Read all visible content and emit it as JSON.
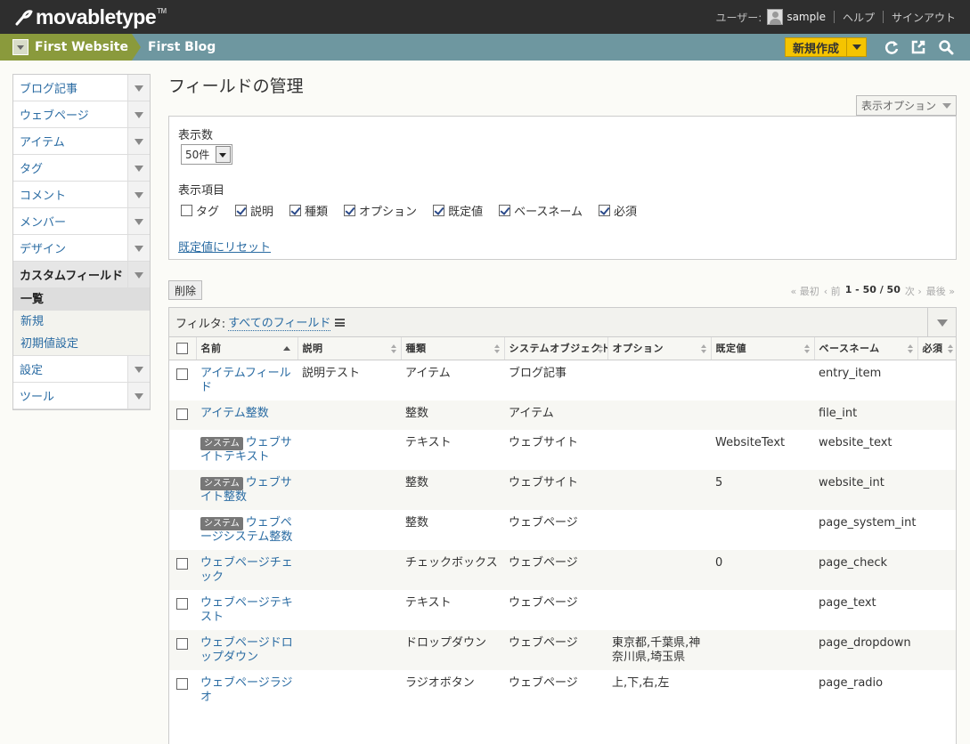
{
  "header": {
    "logo": "movabletype",
    "tm": "TM",
    "user_label": "ユーザー:",
    "user_name": "sample",
    "help": "ヘルプ",
    "signout": "サインアウト"
  },
  "sitebar": {
    "website": "First Website",
    "blog": "First Blog",
    "new_button": "新規作成"
  },
  "sidebar": {
    "items": [
      {
        "label": "ブログ記事"
      },
      {
        "label": "ウェブページ"
      },
      {
        "label": "アイテム"
      },
      {
        "label": "タグ"
      },
      {
        "label": "コメント"
      },
      {
        "label": "メンバー"
      },
      {
        "label": "デザイン"
      },
      {
        "label": "カスタムフィールド"
      },
      {
        "label": "設定"
      },
      {
        "label": "ツール"
      }
    ],
    "subitems": [
      {
        "label": "一覧"
      },
      {
        "label": "新規"
      },
      {
        "label": "初期値設定"
      }
    ]
  },
  "page": {
    "title": "フィールドの管理",
    "display_options": "表示オプション"
  },
  "options": {
    "count_label": "表示数",
    "count_value": "50件",
    "columns_label": "表示項目",
    "columns": [
      {
        "label": "タグ",
        "checked": false
      },
      {
        "label": "説明",
        "checked": true
      },
      {
        "label": "種類",
        "checked": true
      },
      {
        "label": "オプション",
        "checked": true
      },
      {
        "label": "既定値",
        "checked": true
      },
      {
        "label": "ベースネーム",
        "checked": true
      },
      {
        "label": "必須",
        "checked": true
      }
    ],
    "reset": "既定値にリセット"
  },
  "actions": {
    "delete": "削除"
  },
  "pager": {
    "first": "« 最初",
    "prev": "‹ 前",
    "range": "1 - 50 / 50",
    "next": "次 ›",
    "last": "最後 »"
  },
  "filter": {
    "label": "フィルタ:",
    "value": "すべてのフィールド"
  },
  "table": {
    "headers": [
      "名前",
      "説明",
      "種類",
      "システムオブジェクト",
      "オプション",
      "既定値",
      "ベースネーム",
      "必須"
    ],
    "rows": [
      {
        "checkbox": true,
        "system": false,
        "name": "アイテムフィールド",
        "desc": "説明テスト",
        "type": "アイテム",
        "obj": "ブログ記事",
        "opt": "",
        "def": "",
        "base": "entry_item"
      },
      {
        "checkbox": true,
        "system": false,
        "name": "アイテム整数",
        "desc": "",
        "type": "整数",
        "obj": "アイテム",
        "opt": "",
        "def": "",
        "base": "file_int"
      },
      {
        "checkbox": false,
        "system": true,
        "name": "ウェブサイトテキスト",
        "desc": "",
        "type": "テキスト",
        "obj": "ウェブサイト",
        "opt": "",
        "def": "WebsiteText",
        "base": "website_text"
      },
      {
        "checkbox": false,
        "system": true,
        "name": "ウェブサイト整数",
        "desc": "",
        "type": "整数",
        "obj": "ウェブサイト",
        "opt": "",
        "def": "5",
        "base": "website_int"
      },
      {
        "checkbox": false,
        "system": true,
        "name": "ウェブページシステム整数",
        "desc": "",
        "type": "整数",
        "obj": "ウェブページ",
        "opt": "",
        "def": "",
        "base": "page_system_int"
      },
      {
        "checkbox": true,
        "system": false,
        "name": "ウェブページチェック",
        "desc": "",
        "type": "チェックボックス",
        "obj": "ウェブページ",
        "opt": "",
        "def": "0",
        "base": "page_check"
      },
      {
        "checkbox": true,
        "system": false,
        "name": "ウェブページテキスト",
        "desc": "",
        "type": "テキスト",
        "obj": "ウェブページ",
        "opt": "",
        "def": "",
        "base": "page_text"
      },
      {
        "checkbox": true,
        "system": false,
        "name": "ウェブページドロップダウン",
        "desc": "",
        "type": "ドロップダウン",
        "obj": "ウェブページ",
        "opt": "東京都,千葉県,神奈川県,埼玉県",
        "def": "",
        "base": "page_dropdown"
      },
      {
        "checkbox": true,
        "system": false,
        "name": "ウェブページラジオ",
        "desc": "",
        "type": "ラジオボタン",
        "obj": "ウェブページ",
        "opt": "上,下,右,左",
        "def": "",
        "base": "page_radio"
      }
    ],
    "system_badge": "システム"
  }
}
